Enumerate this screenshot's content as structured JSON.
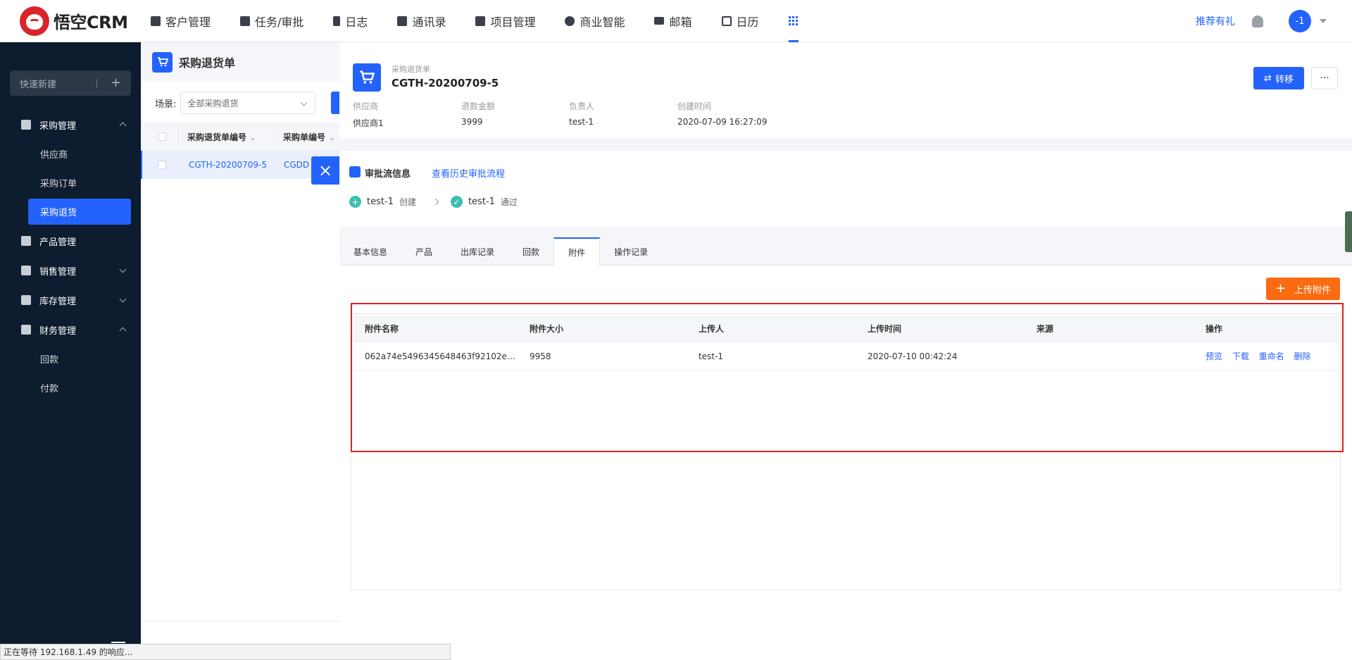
{
  "app": {
    "logo_text": "悟空CRM"
  },
  "nav": {
    "items": [
      {
        "label": "客户管理",
        "icon": "building-icon"
      },
      {
        "label": "任务/审批",
        "icon": "briefcase-icon"
      },
      {
        "label": "日志",
        "icon": "log-icon"
      },
      {
        "label": "通讯录",
        "icon": "phone-book-icon"
      },
      {
        "label": "项目管理",
        "icon": "project-icon"
      },
      {
        "label": "商业智能",
        "icon": "bi-icon"
      },
      {
        "label": "邮箱",
        "icon": "mail-icon"
      },
      {
        "label": "日历",
        "icon": "calendar-icon"
      }
    ],
    "promo": "推荐有礼",
    "avatar_text": "-1"
  },
  "sidebar": {
    "quick_new": "快速新建",
    "groups": [
      {
        "label": "采购管理",
        "expanded": true,
        "children": [
          "供应商",
          "采购订单",
          "采购退货"
        ],
        "active_child": 2
      },
      {
        "label": "产品管理",
        "expanded": false,
        "children": []
      },
      {
        "label": "销售管理",
        "expanded": false,
        "children": []
      },
      {
        "label": "库存管理",
        "expanded": false,
        "children": []
      },
      {
        "label": "财务管理",
        "expanded": true,
        "children": [
          "回款",
          "付款"
        ]
      }
    ]
  },
  "list": {
    "title": "采购退货单",
    "scene_label": "场景:",
    "scene_value": "全部采购退货",
    "columns": [
      "采购退货单编号",
      "采购单编号"
    ],
    "rows": [
      {
        "code": "CGTH-20200709-5",
        "order": "CGDD"
      }
    ]
  },
  "detail": {
    "type_label": "采购退货单",
    "title": "CGTH-20200709-5",
    "transfer_label": "转移",
    "more_label": "···",
    "fields": [
      {
        "key": "供应商",
        "value": "供应商1"
      },
      {
        "key": "退款金额",
        "value": "3999"
      },
      {
        "key": "负责人",
        "value": "test-1"
      },
      {
        "key": "创建时间",
        "value": "2020-07-09 16:27:09"
      }
    ],
    "approval": {
      "title": "审批流信息",
      "history_link": "查看历史审批流程",
      "steps": [
        {
          "who": "test-1",
          "action": "创建",
          "icon": "plus-circle-icon"
        },
        {
          "who": "test-1",
          "action": "通过",
          "icon": "check-circle-icon"
        }
      ]
    },
    "tabs": [
      "基本信息",
      "产品",
      "出库记录",
      "回款",
      "附件",
      "操作记录"
    ],
    "active_tab": 4,
    "upload_label": "上传附件",
    "attachments": {
      "columns": [
        "附件名称",
        "附件大小",
        "上传人",
        "上传时间",
        "来源",
        "操作"
      ],
      "rows": [
        {
          "name": "062a74e5496345648463f92102ec...",
          "size": "9958",
          "uploader": "test-1",
          "time": "2020-07-10 00:42:24",
          "source": ""
        }
      ],
      "ops": [
        "预览",
        "下载",
        "重命名",
        "删除"
      ]
    }
  },
  "status_bar": "正在等待 192.168.1.49 的响应..."
}
